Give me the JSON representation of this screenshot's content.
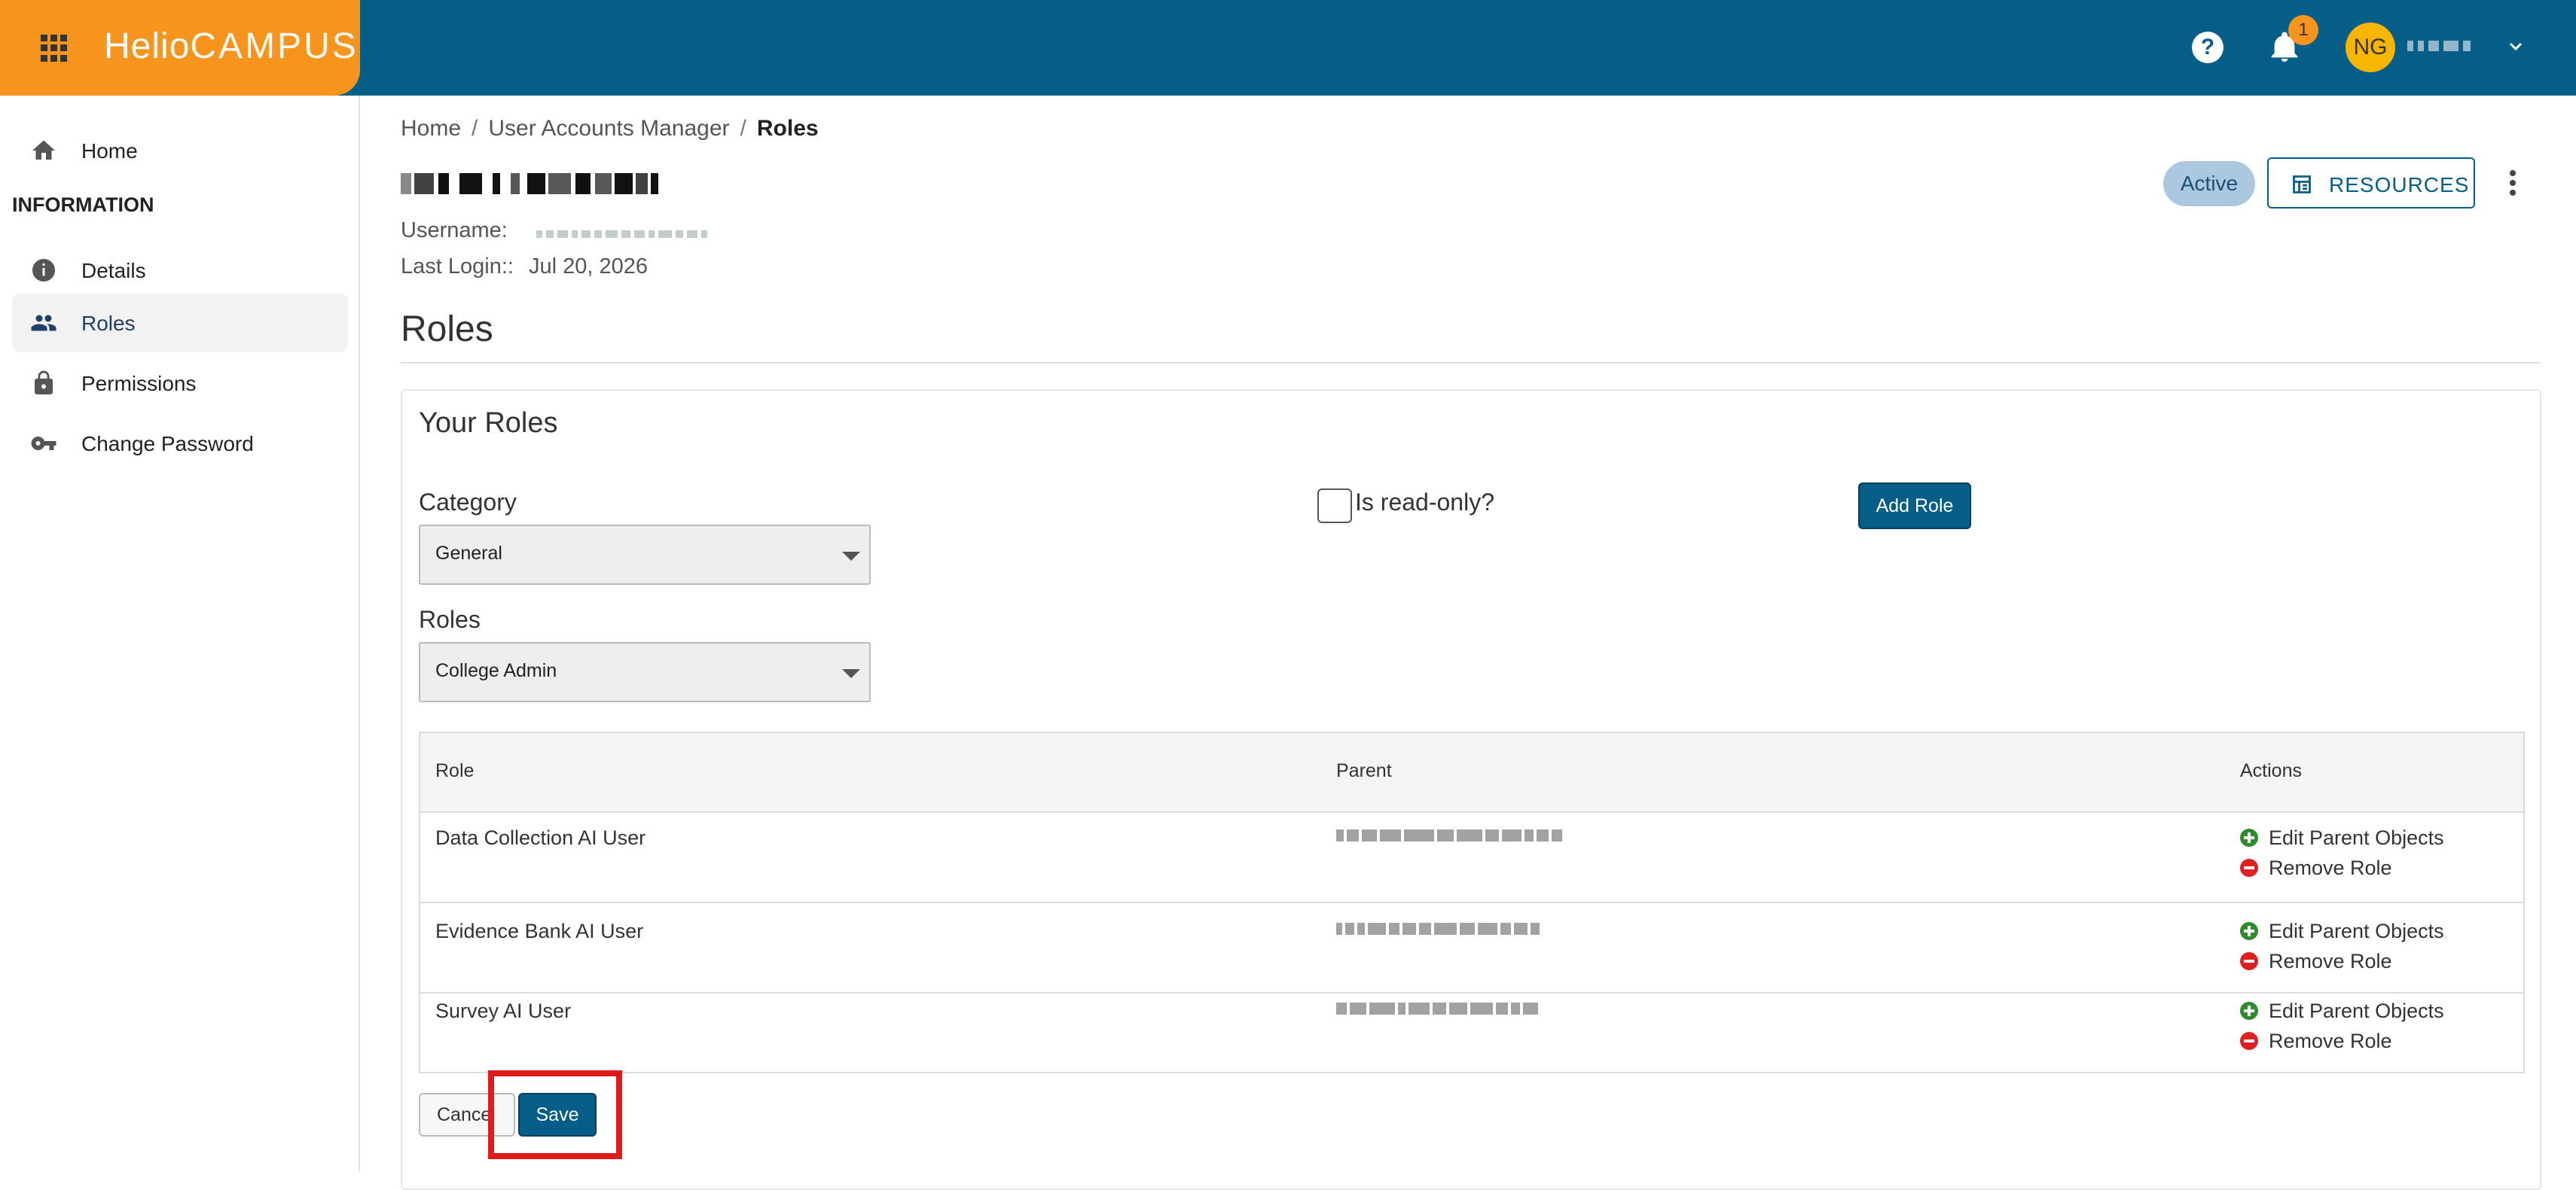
{
  "header": {
    "brand_part1": "Helio",
    "brand_part2": "CAMPUS",
    "help_label": "?",
    "notifications_count": "1",
    "avatar_initials": "NG"
  },
  "sidebar": {
    "section_header": "INFORMATION",
    "items": [
      {
        "label": "Home",
        "icon": "home-icon"
      },
      {
        "label": "Details",
        "icon": "info-icon"
      },
      {
        "label": "Roles",
        "icon": "people-icon",
        "active": true
      },
      {
        "label": "Permissions",
        "icon": "lock-icon"
      },
      {
        "label": "Change Password",
        "icon": "key-icon"
      }
    ]
  },
  "breadcrumb": {
    "items": [
      "Home",
      "User Accounts Manager",
      "Roles"
    ],
    "separator": "/"
  },
  "user": {
    "username_label": "Username:",
    "last_login_label": "Last Login::",
    "last_login_value": "Jul 20, 2026",
    "status": "Active"
  },
  "actions": {
    "resources_label": "RESOURCES"
  },
  "page": {
    "title": "Roles"
  },
  "roles_card": {
    "title": "Your Roles",
    "category_label": "Category",
    "category_value": "General",
    "roles_label": "Roles",
    "roles_value": "College Admin",
    "readonly_label": "Is read-only?",
    "readonly_checked": false,
    "add_role_label": "Add Role",
    "table": {
      "headers": [
        "Role",
        "Parent",
        "Actions"
      ],
      "rows": [
        {
          "role": "Data Collection AI User",
          "action_edit": "Edit Parent Objects",
          "action_remove": "Remove Role"
        },
        {
          "role": "Evidence Bank AI User",
          "action_edit": "Edit Parent Objects",
          "action_remove": "Remove Role"
        },
        {
          "role": "Survey AI User",
          "action_edit": "Edit Parent Objects",
          "action_remove": "Remove Role"
        }
      ]
    },
    "cancel_label": "Cancel",
    "save_label": "Save"
  },
  "colors": {
    "topbar": "#045e87",
    "brand": "#f7941d",
    "accent": "#045e87",
    "highlight": "#e01a1a"
  }
}
